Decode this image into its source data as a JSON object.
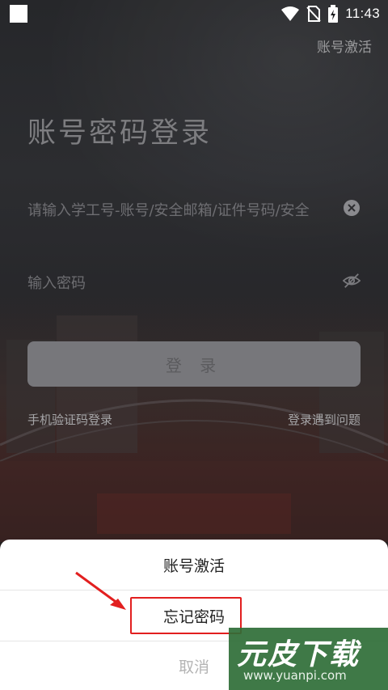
{
  "status_bar": {
    "time": "11:43",
    "icons": [
      "app-square-icon",
      "wifi-icon",
      "no-sim-icon",
      "battery-charging-icon"
    ]
  },
  "header": {
    "activate_link": "账号激活"
  },
  "login": {
    "title": "账号密码登录",
    "account_placeholder": "请输入学工号-账号/安全邮箱/证件号码/安全",
    "password_placeholder": "输入密码",
    "login_button": "登 录",
    "sms_login_link": "手机验证码登录",
    "problem_link": "登录遇到问题"
  },
  "action_sheet": {
    "items": [
      "账号激活",
      "忘记密码"
    ],
    "cancel": "取消"
  },
  "watermark": {
    "brand": "元皮下载",
    "url": "www.yuanpi.com"
  },
  "colors": {
    "highlight_box": "#e21f1f",
    "watermark_bg": "#2f6e37"
  }
}
